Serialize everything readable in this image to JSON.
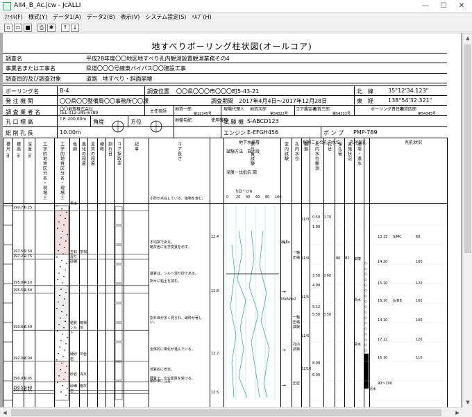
{
  "window": {
    "title": "AII4_B_Ac.jcw - JcALLI",
    "controls": [
      "—",
      "☐",
      "✕"
    ]
  },
  "menu": [
    {
      "label": "ﾌｧｲﾙ(F)"
    },
    {
      "label": "様式(Y)"
    },
    {
      "label": "データ1(A)"
    },
    {
      "label": "データ2(B)"
    },
    {
      "label": "表示(V)"
    },
    {
      "label": "システム設定(S)"
    },
    {
      "label": "ﾍﾙﾌﾟ(H)"
    }
  ],
  "toolbar": [
    "new-icon",
    "open-icon",
    "save-icon",
    "print-icon",
    "settings-icon",
    "arrow-up-icon",
    "arrow-down-icon"
  ],
  "doc": {
    "title": "地すべりボーリング柱状図(オールコア)",
    "rows": [
      {
        "label": "調査名",
        "value": "平成28年度〇〇地区地すべり孔内観測設置観測業務その4"
      },
      {
        "label": "事業名または工事名",
        "value": "県道〇〇〇号線東バイパス〇〇建設工事"
      },
      {
        "label": "調査目的及び調査対象",
        "value": "道路　地すべり・斜面崩壊"
      }
    ],
    "boring_name_label": "ボーリング名",
    "boring_name": "B-4",
    "location_label": "調査位置",
    "location": "〇〇県〇〇〇市〇〇〇町5-43-21",
    "lat_label": "北　緯",
    "lat": "35°12'34.123\"",
    "ordering_label": "発 注 機 関",
    "ordering": "〇〇県〇〇整備局〇〇事務所〇〇課",
    "period_label": "調査期間",
    "period": "2017年4月4日～2017年12月28日",
    "lon_label": "東　経",
    "lon": "138°54'32.321\"",
    "company_label": "調 査 業 者 名",
    "company": "〇〇地質株式会社",
    "tel": "TEL 012-345-6789",
    "chief_label": "主任技師",
    "chief_name": "地質一郎",
    "chief_reg": "第12345号",
    "site_agent_label": "現場代理人",
    "site_agent": "地質次郎",
    "site_agent_reg": "第54322号",
    "core_label": "コア鑑定者",
    "core_name": "地質三郎",
    "core_reg": "第54333号",
    "boring_chief_label": "ボーリング責任者",
    "boring_chief": "地質四郎",
    "boring_chief_reg": "第54345号",
    "elev_label": "孔 口 標 高",
    "elev": "T.P. 200.00m",
    "angle_label": "角度",
    "dir_label": "方位",
    "gradient_label": "地盤勾配",
    "machine_label": "使用機種",
    "tester_label": "試 験 機",
    "tester": "S-ABCD123",
    "depth_label": "総 削 孔 長",
    "depth": "10.00m",
    "engine_label": "エンジン",
    "engine": "E-EFGH456",
    "pump_label": "ポ ン プ",
    "pump": "PMP-789",
    "angle_marks": {
      "top": "上",
      "bottom": "下",
      "left": "0°",
      "right": "90°"
    },
    "dir_marks": {
      "n": "北",
      "s": "南",
      "e": "東",
      "w": "西"
    }
  },
  "columns": [
    "標尺 m",
    "標高 m",
    "深度 m",
    "工学的地質区分名・現場土質名",
    "工学的地質区分名・現場土質名(模式)",
    "色調",
    "風化の程度",
    "変質の程度",
    "硬軟",
    "割れ目",
    "コア採取率",
    "記事",
    "コア長さ",
    "地下水検層",
    "原位置試験",
    "室内試験",
    "孔内水位",
    "掘進",
    "孔内水位観測",
    "孔径",
    "保孔管",
    "実施状況",
    "崩壊・逸水",
    "削孔状況"
  ],
  "groundwater": {
    "title": "地下水検層",
    "method": "試験方法　自／段",
    "depth_label": "深度－比抵抗 図",
    "unit": "kΩ・cm",
    "ticks": [
      "0",
      "20",
      "40",
      "60",
      "80",
      "100"
    ]
  },
  "water_level_header": "掘削ごとの孔内水位",
  "casing_header": "孔径保孔",
  "drill_header": "削孔状況",
  "rows": [
    {
      "elev": "199.75",
      "depth": "0.25",
      "name": "表土",
      "color": "",
      "note": "小砂が点在している。植物を含む。"
    },
    {
      "elev": "197.50",
      "depth": "2.50",
      "name": "",
      "color": "",
      "note": "不均質である。"
    },
    {
      "elev": "197.25",
      "depth": "2.75",
      "name": "玉石混り砂礫",
      "color": "茶褐",
      "note": "暗灰色に化学変質を示す。"
    },
    {
      "elev": "195.80",
      "depth": "4.10",
      "name": "",
      "color": "",
      "note": "基質は、シルト混り砂である。"
    },
    {
      "elev": "195.50",
      "depth": "4.50",
      "name": "",
      "color": "",
      "note": "所々に粘土を挟む。"
    },
    {
      "elev": "193.60",
      "depth": "6.40",
      "name": "粘質シルト",
      "color": "暗褐灰",
      "note": "割れ目が多く見られ、破砕が著しい。"
    },
    {
      "elev": "192.00",
      "depth": "8.00",
      "name": "硬砂岩",
      "color": "灰色",
      "note": "全体的に風化が進んでいる。"
    },
    {
      "elev": "190.95",
      "depth": "9.05",
      "name": "砂岩",
      "color": "青灰",
      "note": "地質的に安定。"
    },
    {
      "elev": "190.51",
      "depth": "9.49",
      "name": "",
      "color": "",
      "note": "硬質で、やや変質を受ける。"
    },
    {
      "elev": "190.35",
      "depth": "9.65",
      "name": "砂礫岩",
      "color": "暗灰",
      "note": "破砕帯に注意。"
    }
  ],
  "right_values": [
    {
      "no": "0.50",
      "v": "0.70"
    },
    {
      "no": "1.00",
      "v": ""
    },
    {
      "no": "3.50",
      "v": "3.60"
    },
    {
      "no": "4.00",
      "v": ""
    },
    {
      "no": "5.12",
      "v": ""
    },
    {
      "no": "5.50",
      "v": "6.50"
    },
    {
      "no": "8.00",
      "v": ""
    },
    {
      "no": "6.00",
      "v": ""
    }
  ],
  "drill_values": [
    {
      "a": "13.15",
      "b": "S/MC",
      "c": "60"
    },
    {
      "a": "14.20",
      "b": "",
      "c": "100"
    },
    {
      "a": "15.10",
      "b": "",
      "c": "120"
    },
    {
      "a": "16.10",
      "b": "G/DB",
      "c": "100"
    },
    {
      "a": "14.10",
      "b": "",
      "c": "100"
    },
    {
      "a": "17.12",
      "b": "",
      "c": "120"
    },
    {
      "a": "16.10",
      "b": "",
      "c": "110"
    },
    {
      "a": "90～100",
      "b": "",
      "c": ""
    }
  ],
  "misc_labels": {
    "n1": "2MPa",
    "n2": "55kN/m2",
    "lab1": "一軸圧縮",
    "lab2": "一軸圧縮試験",
    "lab3": "孔内試験",
    "lab4": "圧密",
    "r1": "11/3",
    "r2": "11/4",
    "r3": "11/5",
    "r4": "11/6",
    "r5": "12/10",
    "water_label": "清水",
    "casing1": "86",
    "casing2": "B2",
    "drill_flag": "崩壊",
    "cl_big": "泥水"
  },
  "core_lengths": [
    "12.4",
    "12.8",
    "12.7",
    "12.5"
  ]
}
